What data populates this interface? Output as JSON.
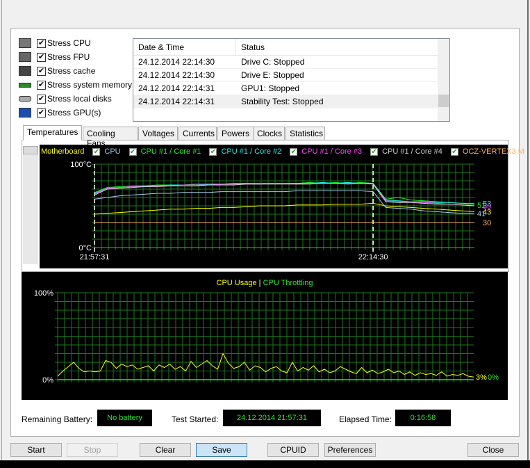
{
  "options": [
    {
      "label": "Stress CPU",
      "checked": true,
      "icon": "cpu-icon"
    },
    {
      "label": "Stress FPU",
      "checked": true,
      "icon": "fpu-icon"
    },
    {
      "label": "Stress cache",
      "checked": true,
      "icon": "cache-chip-icon"
    },
    {
      "label": "Stress system memory",
      "checked": true,
      "icon": "memory-icon"
    },
    {
      "label": "Stress local disks",
      "checked": true,
      "icon": "disk-icon"
    },
    {
      "label": "Stress GPU(s)",
      "checked": true,
      "icon": "gpu-monitor-icon"
    }
  ],
  "log": {
    "headers": [
      "Date & Time",
      "Status"
    ],
    "rows": [
      {
        "time": "24.12.2014 22:14:30",
        "status": "Drive C: Stopped"
      },
      {
        "time": "24.12.2014 22:14:30",
        "status": "Drive E: Stopped"
      },
      {
        "time": "24.12.2014 22:14:31",
        "status": "GPU1: Stopped"
      },
      {
        "time": "24.12.2014 22:14:31",
        "status": "Stability Test: Stopped"
      }
    ]
  },
  "tabs": [
    "Temperatures",
    "Cooling Fans",
    "Voltages",
    "Currents",
    "Powers",
    "Clocks",
    "Statistics"
  ],
  "status": {
    "battery_label": "Remaining Battery:",
    "battery_value": "No battery",
    "started_label": "Test Started:",
    "started_value": "24.12.2014 21:57:31",
    "elapsed_label": "Elapsed Time:",
    "elapsed_value": "0:16:58"
  },
  "buttons": {
    "start": "Start",
    "stop": "Stop",
    "clear": "Clear",
    "save": "Save",
    "cpuid": "CPUID",
    "preferences": "Preferences",
    "close": "Close"
  },
  "chart_data": [
    {
      "type": "line",
      "title": "Temperatures",
      "ylim": [
        0,
        100
      ],
      "ytick_top": "100°C",
      "ytick_bottom": "0°C",
      "x_labels": [
        "21:57:31",
        "22:14:30"
      ],
      "marker_index": 22,
      "series": [
        {
          "name": "Motherboard",
          "color": "#ffff00",
          "checked": null,
          "values": [
            40,
            41,
            42,
            43,
            44,
            45,
            46,
            46,
            47,
            47,
            48,
            48,
            49,
            50,
            50,
            50,
            51,
            51,
            51,
            52,
            52,
            52,
            53,
            50,
            49,
            48,
            47,
            46,
            45,
            44,
            43
          ],
          "end_label": "43"
        },
        {
          "name": "CPU",
          "color": "#a8c8f0",
          "checked": true,
          "values": [
            58,
            60,
            62,
            63,
            64,
            65,
            65,
            66,
            66,
            66,
            67,
            67,
            67,
            67,
            67,
            67,
            68,
            68,
            68,
            68,
            68,
            68,
            67,
            48,
            47,
            46,
            44,
            43,
            42,
            41,
            41
          ],
          "end_label": "41"
        },
        {
          "name": "CPU #1 / Core #1",
          "color": "#22ee22",
          "checked": true,
          "values": [
            66,
            72,
            73,
            74,
            74,
            75,
            75,
            75,
            76,
            76,
            76,
            76,
            77,
            77,
            77,
            77,
            77,
            78,
            77,
            78,
            77,
            78,
            77,
            58,
            60,
            57,
            56,
            55,
            54,
            53,
            51
          ],
          "end_label": "51"
        },
        {
          "name": "CPU #1 / Core #2",
          "color": "#22eeee",
          "checked": true,
          "values": [
            65,
            71,
            72,
            73,
            74,
            74,
            75,
            75,
            75,
            76,
            76,
            77,
            77,
            76,
            77,
            77,
            77,
            77,
            78,
            77,
            78,
            77,
            77,
            57,
            56,
            55,
            55,
            54,
            54,
            53,
            53
          ],
          "end_label": "53"
        },
        {
          "name": "CPU #1 / Core #3",
          "color": "#ff44ff",
          "checked": true,
          "values": [
            64,
            71,
            72,
            73,
            73,
            74,
            74,
            75,
            75,
            75,
            76,
            76,
            76,
            76,
            77,
            77,
            76,
            77,
            77,
            77,
            77,
            77,
            76,
            56,
            55,
            55,
            54,
            53,
            52,
            51,
            50
          ],
          "end_label": "50"
        },
        {
          "name": "CPU #1 / Core #4",
          "color": "#d0d0d0",
          "checked": true,
          "values": [
            63,
            70,
            71,
            72,
            73,
            73,
            74,
            74,
            74,
            75,
            75,
            75,
            76,
            76,
            76,
            76,
            76,
            76,
            77,
            77,
            76,
            77,
            76,
            55,
            54,
            54,
            53,
            52,
            52,
            51,
            50
          ],
          "end_label": ""
        },
        {
          "name": "OCZ-VERTEX3 M",
          "color": "#ffb060",
          "checked": true,
          "values": [
            30,
            30,
            30,
            30,
            30,
            30,
            30,
            30,
            30,
            30,
            30,
            30,
            30,
            30,
            30,
            30,
            30,
            30,
            30,
            30,
            30,
            30,
            30,
            30,
            30,
            30,
            30,
            30,
            30,
            30,
            30
          ],
          "end_label": "30"
        }
      ]
    },
    {
      "type": "line",
      "title_usage": "CPU Usage",
      "separator": "|",
      "title_throttling": "CPU Throttling",
      "ylim": [
        0,
        100
      ],
      "ytick_top": "100%",
      "ytick_bottom": "0%",
      "series": [
        {
          "name": "CPU Usage",
          "color": "#ffff00",
          "end_label": "3%",
          "values": [
            4,
            10,
            15,
            20,
            13,
            9,
            10,
            9,
            10,
            22,
            20,
            13,
            18,
            15,
            17,
            12,
            14,
            16,
            10,
            17,
            14,
            18,
            12,
            15,
            10,
            21,
            14,
            18,
            22,
            16,
            12,
            30,
            19,
            13,
            15,
            20,
            11,
            16,
            14,
            9,
            13,
            15,
            10,
            8,
            20,
            10,
            14,
            11,
            16,
            9,
            12,
            8,
            10,
            15,
            12,
            9,
            7,
            14,
            8,
            11,
            7,
            9,
            12,
            8,
            10,
            6,
            9,
            5,
            8,
            6,
            7,
            5,
            9,
            4,
            6,
            5,
            7,
            4,
            3
          ]
        },
        {
          "name": "CPU Throttling",
          "color": "#22ee22",
          "end_label": "0%",
          "values": [
            0,
            0
          ]
        }
      ]
    }
  ]
}
